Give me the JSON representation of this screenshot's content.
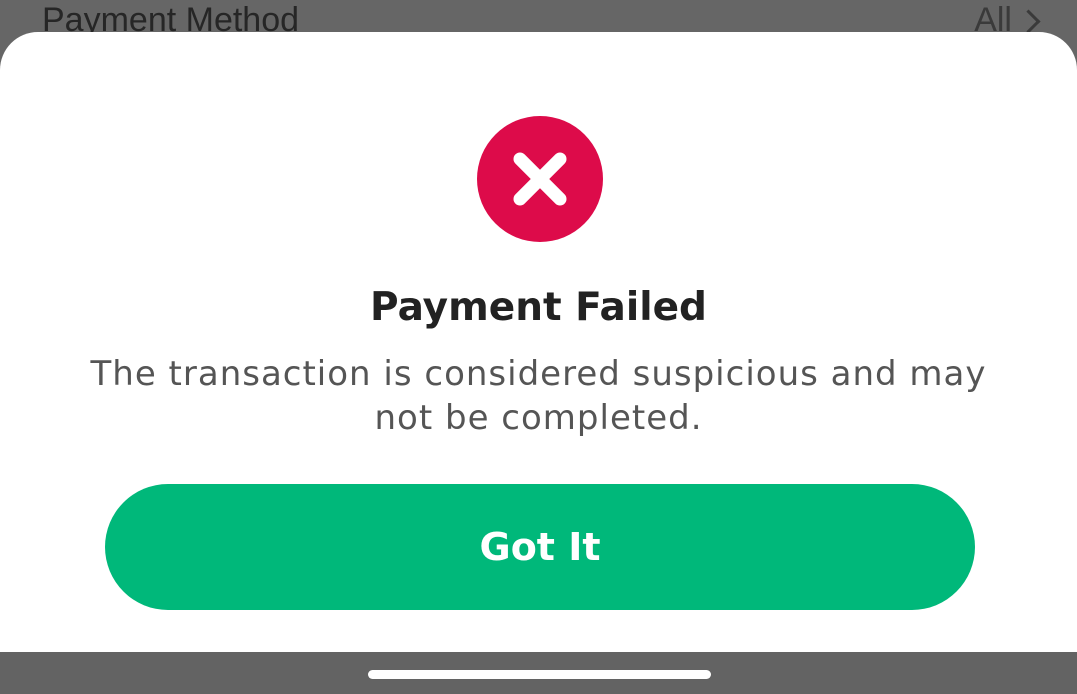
{
  "background": {
    "row_label": "Payment Method",
    "row_value": "All",
    "row_icon": "chevron-right-icon"
  },
  "dialog": {
    "icon": "error-x-icon",
    "icon_color": "#dd0b4a",
    "title": "Payment Failed",
    "message": "The transaction is considered suspicious and may not be completed.",
    "button_label": "Got It",
    "button_color": "#00b87a"
  },
  "navigation": {
    "home_indicator": "home-indicator"
  }
}
